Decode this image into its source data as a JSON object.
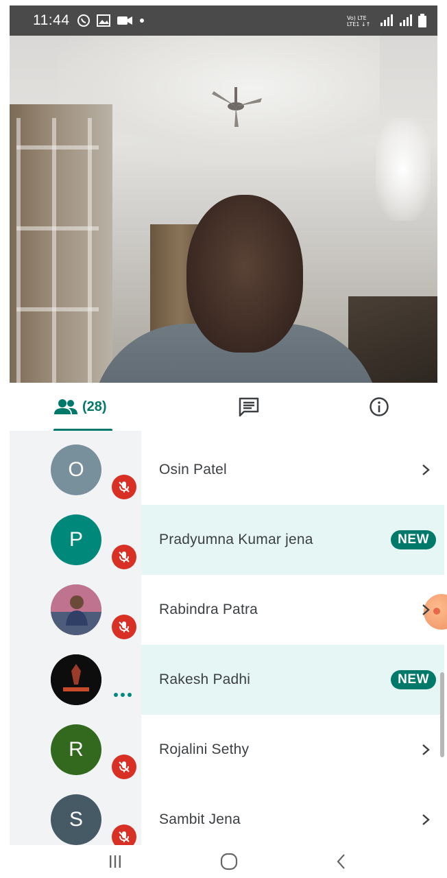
{
  "status_bar": {
    "time": "11:44",
    "left_icons": [
      "whatsapp-icon",
      "gallery-icon",
      "video-icon",
      "dot-icon"
    ],
    "right_icons": [
      "volte-lte-icon",
      "signal-icon",
      "signal-icon-2",
      "battery-icon"
    ]
  },
  "tabs": {
    "people_count": "(28)",
    "items": [
      "people-icon",
      "chat-icon",
      "info-icon"
    ]
  },
  "participants": [
    {
      "name": "Osin Patel",
      "initial": "O",
      "avatar_color": "#78909c",
      "status": "muted",
      "badge": ""
    },
    {
      "name": "Pradyumna Kumar jena",
      "initial": "P",
      "avatar_color": "#00897b",
      "status": "muted",
      "badge": "NEW"
    },
    {
      "name": "Rabindra Patra",
      "initial": "",
      "avatar_color": "#8d6e63",
      "status": "muted",
      "badge": ""
    },
    {
      "name": "Rakesh Padhi",
      "initial": "",
      "avatar_color": "#111111",
      "status": "speaking",
      "badge": "NEW"
    },
    {
      "name": "Rojalini Sethy",
      "initial": "R",
      "avatar_color": "#33691e",
      "status": "muted",
      "badge": ""
    },
    {
      "name": "Sambit Jena",
      "initial": "S",
      "avatar_color": "#455a64",
      "status": "muted",
      "badge": ""
    }
  ],
  "colors": {
    "accent": "#00796b",
    "mute": "#d93025",
    "highlight": "#e6f6f4"
  }
}
